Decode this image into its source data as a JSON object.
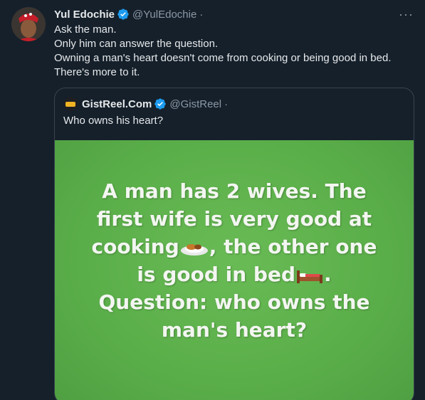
{
  "tweet": {
    "display_name": "Yul Edochie",
    "handle": "@YulEdochie",
    "separator": "·",
    "more_label": "···",
    "lines": [
      "Ask the man.",
      "Only him can answer the question.",
      "Owning a man's heart doesn't come from cooking or being good in bed.",
      "There's more to it."
    ]
  },
  "quote": {
    "display_name": "GistReel.Com",
    "handle": "@GistReel",
    "separator": "·",
    "text": "Who owns his heart?",
    "image_text": {
      "line1": "A man has 2 wives. The",
      "line2": "first wife is very good at",
      "line3_a": "cooking",
      "line3_b": ", the other one",
      "line4_a": "is good in bed",
      "line4_b": ".",
      "line5": "Question: who owns the",
      "line6": "man's heart?"
    }
  },
  "colors": {
    "background": "#15202b",
    "verified": "#1d9bf0",
    "image_green": "#5aae49"
  },
  "icons": [
    "avatar",
    "verified-badge-icon",
    "more-icon",
    "food-plate-emoji",
    "bed-emoji"
  ]
}
